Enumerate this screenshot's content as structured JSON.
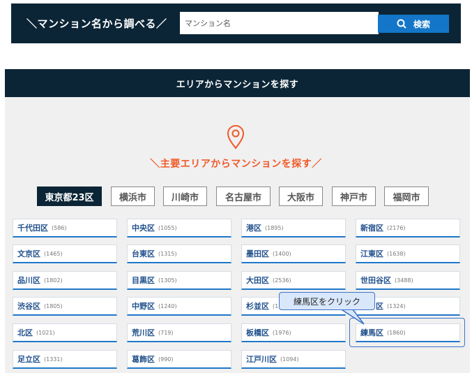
{
  "search": {
    "title": "＼マンション名から調べる／",
    "placeholder": "マンション名",
    "button_label": "検索"
  },
  "area": {
    "header": "エリアからマンションを探す",
    "subheading": "＼主要エリアからマンションを探す／",
    "city_tabs": [
      {
        "label": "東京都23区",
        "active": true
      },
      {
        "label": "横浜市",
        "active": false
      },
      {
        "label": "川崎市",
        "active": false
      },
      {
        "label": "名古屋市",
        "active": false
      },
      {
        "label": "大阪市",
        "active": false
      },
      {
        "label": "神戸市",
        "active": false
      },
      {
        "label": "福岡市",
        "active": false
      }
    ],
    "wards": [
      {
        "name": "千代田区",
        "count": "(586)"
      },
      {
        "name": "中央区",
        "count": "(1055)"
      },
      {
        "name": "港区",
        "count": "(1895)"
      },
      {
        "name": "新宿区",
        "count": "(2176)"
      },
      {
        "name": "文京区",
        "count": "(1465)"
      },
      {
        "name": "台東区",
        "count": "(1315)"
      },
      {
        "name": "墨田区",
        "count": "(1400)"
      },
      {
        "name": "江東区",
        "count": "(1638)"
      },
      {
        "name": "品川区",
        "count": "(1802)"
      },
      {
        "name": "目黒区",
        "count": "(1305)"
      },
      {
        "name": "大田区",
        "count": "(2536)"
      },
      {
        "name": "世田谷区",
        "count": "(3488)"
      },
      {
        "name": "渋谷区",
        "count": "(1805)"
      },
      {
        "name": "中野区",
        "count": "(1240)"
      },
      {
        "name": "杉並区",
        "count": "(1"
      },
      {
        "name": "区",
        "count": "(1324)"
      },
      {
        "name": "北区",
        "count": "(1021)"
      },
      {
        "name": "荒川区",
        "count": "(719)"
      },
      {
        "name": "板橋区",
        "count": "(1976)"
      },
      {
        "name": "練馬区",
        "count": "(1860)"
      },
      {
        "name": "足立区",
        "count": "(1331)"
      },
      {
        "name": "葛飾区",
        "count": "(990)"
      },
      {
        "name": "江戸川区",
        "count": "(1094)"
      }
    ]
  },
  "callout": {
    "text": "練馬区をクリック"
  },
  "colors": {
    "navy": "#0b2536",
    "accent_orange": "#f05a28",
    "search_button_blue": "#1476c9",
    "ward_underline_blue": "#1f77c9",
    "callout_bg": "#d9e7fb"
  },
  "icons": {
    "search_button": "magnifier-icon",
    "area_heading": "map-pin-icon"
  }
}
